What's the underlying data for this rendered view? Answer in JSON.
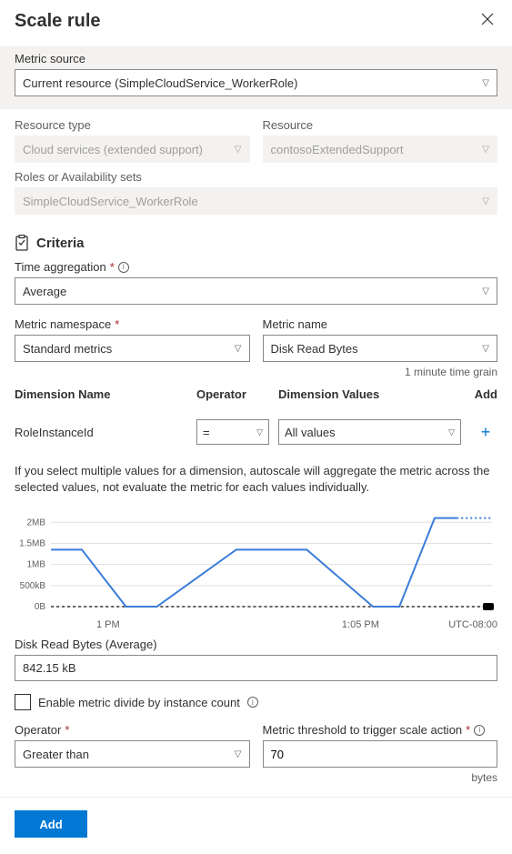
{
  "header": {
    "title": "Scale rule"
  },
  "metric_source": {
    "label": "Metric source",
    "value": "Current resource (SimpleCloudService_WorkerRole)"
  },
  "resource_type": {
    "label": "Resource type",
    "value": "Cloud services (extended support)"
  },
  "resource": {
    "label": "Resource",
    "value": "contosoExtendedSupport"
  },
  "roles": {
    "label": "Roles or Availability sets",
    "value": "SimpleCloudService_WorkerRole"
  },
  "criteria": {
    "title": "Criteria"
  },
  "time_aggregation": {
    "label": "Time aggregation",
    "value": "Average"
  },
  "metric_namespace": {
    "label": "Metric namespace",
    "value": "Standard metrics"
  },
  "metric_name": {
    "label": "Metric name",
    "value": "Disk Read Bytes"
  },
  "time_grain": "1 minute time grain",
  "dim_headers": {
    "name": "Dimension Name",
    "operator": "Operator",
    "values": "Dimension Values",
    "add": "Add"
  },
  "dim_row": {
    "name": "RoleInstanceId",
    "operator": "=",
    "value": "All values"
  },
  "help_text": "If you select multiple values for a dimension, autoscale will aggregate the metric across the selected values, not evaluate the metric for each values individually.",
  "chart_data": {
    "type": "line",
    "series": [
      {
        "name": "Disk Read Bytes",
        "x": [
          0,
          0.07,
          0.17,
          0.24,
          0.42,
          0.5,
          0.58,
          0.73,
          0.79,
          0.87,
          0.92
        ],
        "values": [
          1.35,
          1.35,
          0,
          0,
          1.35,
          1.35,
          1.35,
          0,
          0,
          2.1,
          2.1
        ]
      }
    ],
    "y_ticks": [
      "0B",
      "500kB",
      "1MB",
      "1.5MB",
      "2MB"
    ],
    "ylim": [
      0,
      2.2
    ],
    "x_labels": {
      "left": "1 PM",
      "mid": "1:05 PM",
      "right": "UTC-08:00"
    }
  },
  "chart_metric_label": "Disk Read Bytes (Average)",
  "chart_value": "842.15 kB",
  "enable_divide": {
    "label": "Enable metric divide by instance count",
    "checked": false
  },
  "operator": {
    "label": "Operator",
    "value": "Greater than"
  },
  "threshold": {
    "label": "Metric threshold to trigger scale action",
    "value": "70",
    "unit": "bytes"
  },
  "footer": {
    "add": "Add"
  }
}
